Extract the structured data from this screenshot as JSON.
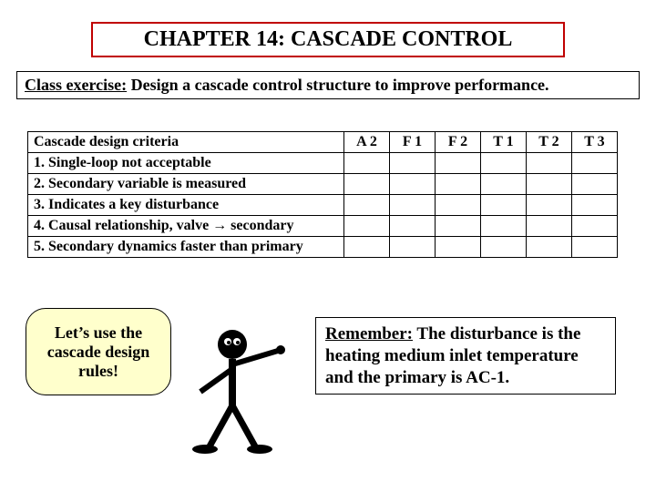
{
  "title": "CHAPTER 14: CASCADE CONTROL",
  "exercise": {
    "label": "Class exercise:",
    "text": " Design a cascade control structure to improve performance."
  },
  "table": {
    "header": [
      "Cascade design criteria",
      "A 2",
      "F 1",
      "F 2",
      "T 1",
      "T 2",
      "T 3"
    ],
    "rows": [
      "1.  Single-loop not acceptable",
      "2.  Secondary variable is measured",
      "3.  Indicates a key disturbance",
      "4.  Causal relationship, valve → secondary",
      "5.  Secondary dynamics faster than primary"
    ]
  },
  "bubble": "Let’s use the cascade design rules!",
  "remember": {
    "label": "Remember:",
    "text": "  The disturbance is the heating medium inlet temperature and the primary is AC-1."
  }
}
